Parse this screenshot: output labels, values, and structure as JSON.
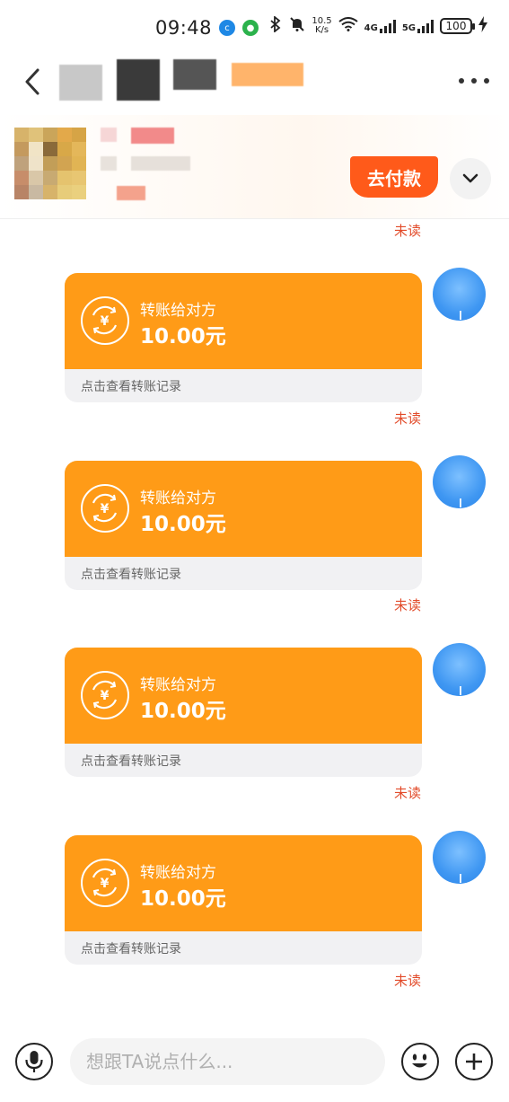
{
  "status_bar": {
    "time": "09:48",
    "speed_value": "10.5",
    "speed_unit": "K/s",
    "net_4g": "4G",
    "net_5g": "5G",
    "battery": "100"
  },
  "shop": {
    "pay_label": "去付款"
  },
  "unread_label": "未读",
  "transfer_messages": [
    {
      "label": "转账给对方",
      "amount": "10.00元",
      "link": "点击查看转账记录",
      "status": "未读"
    },
    {
      "label": "转账给对方",
      "amount": "10.00元",
      "link": "点击查看转账记录",
      "status": "未读"
    },
    {
      "label": "转账给对方",
      "amount": "10.00元",
      "link": "点击查看转账记录",
      "status": "未读"
    },
    {
      "label": "转账给对方",
      "amount": "10.00元",
      "link": "点击查看转账记录",
      "status": "未读"
    }
  ],
  "input_bar": {
    "placeholder": "想跟TA说点什么..."
  },
  "colors": {
    "transfer_orange": "#ff9b17",
    "pay_button": "#ff5a1a",
    "unread_red": "#e24b2a",
    "avatar_blue": "#3f97f2"
  }
}
